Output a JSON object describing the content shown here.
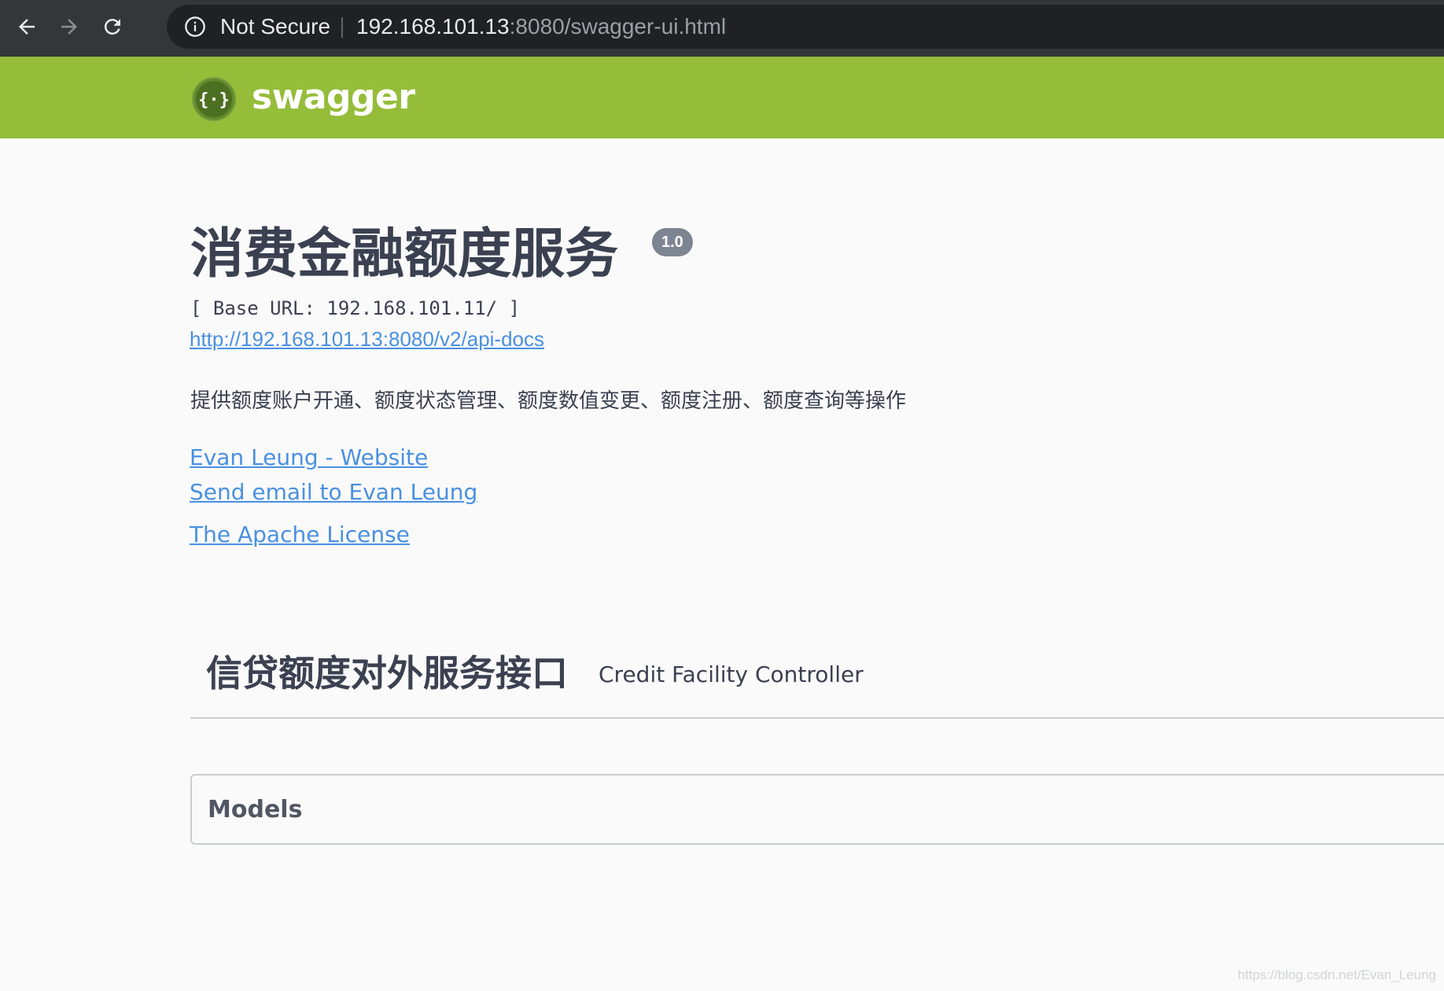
{
  "browser": {
    "security_label": "Not Secure",
    "url_host": "192.168.101.13",
    "url_rest": ":8080/swagger-ui.html"
  },
  "topbar": {
    "logo_text": "swagger",
    "brand_color": "#95bd3a"
  },
  "info": {
    "title": "消费金融额度服务",
    "version": "1.0",
    "base_url": "[ Base URL: 192.168.101.11/ ]",
    "spec_link": "http://192.168.101.13:8080/v2/api-docs",
    "description": "提供额度账户开通、额度状态管理、额度数值变更、额度注册、额度查询等操作",
    "links": {
      "website": "Evan Leung - Website",
      "email": "Send email to Evan Leung",
      "license": "The Apache License"
    }
  },
  "tags": [
    {
      "name": "信贷额度对外服务接口",
      "description": "Credit Facility Controller"
    }
  ],
  "models": {
    "label": "Models"
  },
  "watermark": "https://blog.csdn.net/Evan_Leung",
  "colors": {
    "link": "#4990e2",
    "text": "#3b4151",
    "badge": "#7d8492"
  },
  "icons": {
    "back": "arrow-left-icon",
    "forward": "arrow-right-icon",
    "reload": "reload-icon",
    "info": "info-icon",
    "logo": "swagger-logo-icon"
  }
}
